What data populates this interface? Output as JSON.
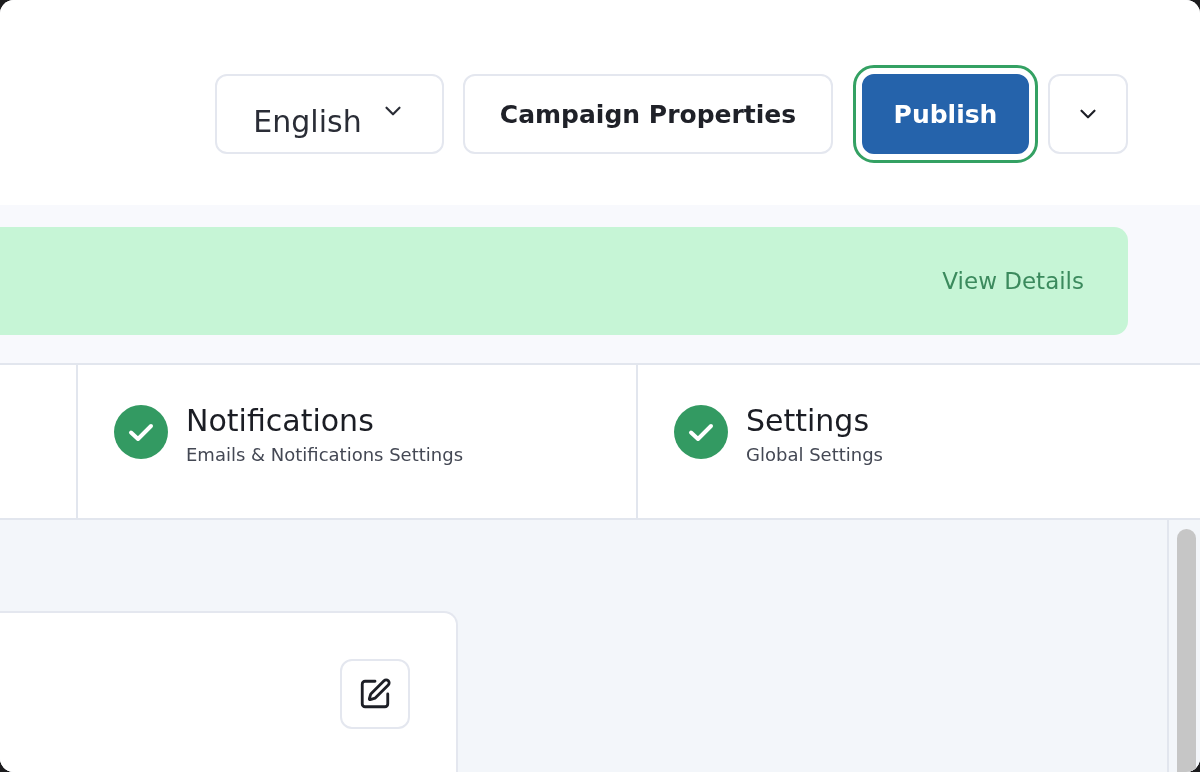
{
  "header": {
    "language_select": {
      "value": "English"
    },
    "buttons": [
      {
        "kind": "secondary",
        "label": "Campaign Properties",
        "focused": false
      },
      {
        "kind": "primary",
        "label": "Publish",
        "focused": true
      },
      {
        "kind": "menu",
        "focused": false
      }
    ]
  },
  "banner": {
    "link": "View Details"
  },
  "steps": [
    {
      "title": "Notifications",
      "subtitle": "Emails & Notifications Settings",
      "completed": true
    },
    {
      "title": "Settings",
      "subtitle": "Global Settings",
      "completed": true
    }
  ]
}
